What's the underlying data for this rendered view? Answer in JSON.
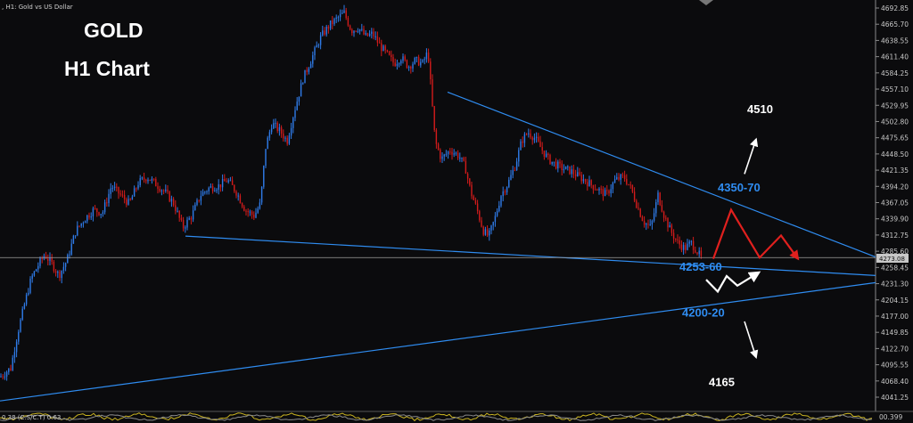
{
  "header": {
    "symbol_line": ", H1:  Gold vs US Dollar"
  },
  "title": {
    "line1": "GOLD",
    "line2": "H1 Chart"
  },
  "chart_data": {
    "type": "candlestick",
    "title": "GOLD H1 Chart",
    "symbol": "Gold vs US Dollar",
    "timeframe": "H1",
    "ylim": [
      4028,
      4705
    ],
    "y_ticks": [
      4692.85,
      4665.7,
      4638.55,
      4611.4,
      4584.25,
      4557.1,
      4529.95,
      4502.8,
      4475.65,
      4448.5,
      4421.35,
      4394.2,
      4367.05,
      4339.9,
      4312.75,
      4285.6,
      4258.45,
      4231.3,
      4204.15,
      4177.0,
      4149.85,
      4122.7,
      4095.55,
      4068.4,
      4041.25
    ],
    "current_price": "4273.08",
    "price_path": [
      [
        0,
        4075
      ],
      [
        12,
        4090
      ],
      [
        20,
        4150
      ],
      [
        28,
        4200
      ],
      [
        35,
        4240
      ],
      [
        42,
        4260
      ],
      [
        50,
        4280
      ],
      [
        58,
        4265
      ],
      [
        66,
        4245
      ],
      [
        75,
        4270
      ],
      [
        85,
        4320
      ],
      [
        95,
        4340
      ],
      [
        105,
        4355
      ],
      [
        115,
        4350
      ],
      [
        125,
        4395
      ],
      [
        135,
        4380
      ],
      [
        145,
        4365
      ],
      [
        155,
        4400
      ],
      [
        165,
        4410
      ],
      [
        175,
        4398
      ],
      [
        185,
        4385
      ],
      [
        195,
        4365
      ],
      [
        205,
        4325
      ],
      [
        215,
        4345
      ],
      [
        225,
        4380
      ],
      [
        235,
        4392
      ],
      [
        245,
        4395
      ],
      [
        255,
        4405
      ],
      [
        265,
        4385
      ],
      [
        275,
        4355
      ],
      [
        285,
        4345
      ],
      [
        292,
        4365
      ],
      [
        298,
        4460
      ],
      [
        305,
        4500
      ],
      [
        315,
        4485
      ],
      [
        322,
        4470
      ],
      [
        330,
        4520
      ],
      [
        340,
        4575
      ],
      [
        350,
        4610
      ],
      [
        360,
        4645
      ],
      [
        370,
        4665
      ],
      [
        378,
        4675
      ],
      [
        386,
        4685
      ],
      [
        394,
        4655
      ],
      [
        402,
        4660
      ],
      [
        410,
        4645
      ],
      [
        418,
        4650
      ],
      [
        426,
        4630
      ],
      [
        434,
        4615
      ],
      [
        442,
        4600
      ],
      [
        450,
        4610
      ],
      [
        458,
        4595
      ],
      [
        466,
        4605
      ],
      [
        474,
        4600
      ],
      [
        480,
        4620
      ],
      [
        484,
        4545
      ],
      [
        488,
        4470
      ],
      [
        495,
        4440
      ],
      [
        505,
        4455
      ],
      [
        515,
        4445
      ],
      [
        522,
        4425
      ],
      [
        528,
        4385
      ],
      [
        535,
        4355
      ],
      [
        542,
        4320
      ],
      [
        548,
        4310
      ],
      [
        555,
        4340
      ],
      [
        562,
        4380
      ],
      [
        570,
        4400
      ],
      [
        578,
        4430
      ],
      [
        585,
        4470
      ],
      [
        592,
        4485
      ],
      [
        600,
        4475
      ],
      [
        608,
        4455
      ],
      [
        615,
        4440
      ],
      [
        622,
        4432
      ],
      [
        630,
        4425
      ],
      [
        640,
        4420
      ],
      [
        650,
        4410
      ],
      [
        660,
        4400
      ],
      [
        670,
        4390
      ],
      [
        680,
        4380
      ],
      [
        690,
        4405
      ],
      [
        700,
        4410
      ],
      [
        708,
        4390
      ],
      [
        715,
        4360
      ],
      [
        722,
        4335
      ],
      [
        730,
        4325
      ],
      [
        738,
        4380
      ],
      [
        745,
        4345
      ],
      [
        752,
        4320
      ],
      [
        760,
        4300
      ],
      [
        768,
        4290
      ],
      [
        775,
        4300
      ],
      [
        782,
        4285
      ],
      [
        787,
        4273
      ]
    ],
    "trendlines": [
      {
        "color": "#2f8cf0",
        "from": [
          502,
          4552
        ],
        "to": [
          982,
          4276
        ]
      },
      {
        "color": "#2f8cf0",
        "from": [
          208,
          4311
        ],
        "to": [
          982,
          4245
        ]
      },
      {
        "color": "#2f8cf0",
        "from": [
          0,
          4035
        ],
        "to": [
          982,
          4233
        ]
      },
      {
        "color": "#a0a0a0",
        "from": [
          0,
          4275
        ],
        "to": [
          982,
          4275
        ]
      }
    ],
    "projections": [
      {
        "color": "#e0201e",
        "path": [
          [
            800,
            4273
          ],
          [
            820,
            4355
          ],
          [
            852,
            4275
          ],
          [
            876,
            4312
          ],
          [
            895,
            4273
          ]
        ]
      },
      {
        "color": "#ffffff",
        "path": [
          [
            792,
            4238
          ],
          [
            805,
            4218
          ],
          [
            815,
            4244
          ],
          [
            827,
            4228
          ],
          [
            851,
            4250
          ]
        ]
      }
    ],
    "arrows": [
      {
        "color": "#ffffff",
        "from": [
          835,
          4415
        ],
        "to": [
          848,
          4473
        ]
      },
      {
        "color": "#ffffff",
        "from": [
          835,
          4168
        ],
        "to": [
          848,
          4108
        ]
      }
    ],
    "annotations": [
      {
        "text": "4510",
        "color": "white",
        "at": [
          838,
          4517
        ]
      },
      {
        "text": "4350-70",
        "color": "blue",
        "at": [
          805,
          4386
        ]
      },
      {
        "text": "4253-60",
        "color": "blue",
        "at": [
          762,
          4253
        ]
      },
      {
        "text": "4200-20",
        "color": "blue",
        "at": [
          765,
          4176
        ]
      },
      {
        "text": "4165",
        "color": "white",
        "at": [
          795,
          4060
        ]
      }
    ],
    "grid": false
  },
  "bottom_indicator": {
    "left_text": "0.38 (C.S/C.T) 0.63",
    "right_value": "00.399"
  }
}
